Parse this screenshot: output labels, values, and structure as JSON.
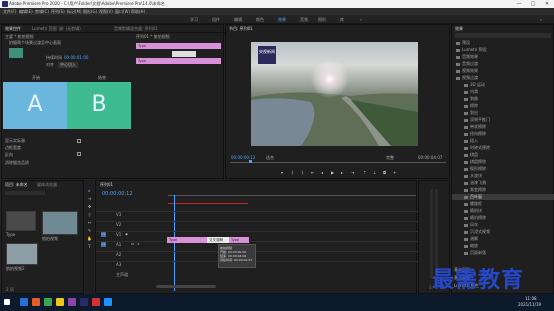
{
  "titlebar": {
    "title": "Adobe Premiere Pro 2020 - C:\\用户\\Folder\\文档\\Adobe\\Premiere Pro\\14.0\\未命名",
    "min": "—",
    "max": "□",
    "close": "✕"
  },
  "menubar": {
    "items": [
      "文件(F)",
      "编辑(E)",
      "剪辑(C)",
      "序列(S)",
      "标记(M)",
      "图形(G)",
      "视图(V)",
      "窗口(W)",
      "帮助(H)"
    ]
  },
  "workspaces": {
    "items": [
      "学习",
      "组件",
      "编辑",
      "颜色",
      "效果",
      "音频",
      "图形",
      "库"
    ],
    "active": "效果"
  },
  "effect_controls": {
    "tabs": [
      "效果控件",
      "Lumetri 范围",
      "源: (无剪辑)",
      "音频剪辑混合器: 序列01"
    ],
    "clip_title": "主要 * 航拍视频",
    "sequence": "序列01 * 航拍视频",
    "description": "拍摄两个场景过渡至中心画面",
    "duration_label": "持续时间",
    "duration_value": "00:00:01:00",
    "alignment_label": "对齐",
    "alignment_value": "中心切入",
    "start_label": "开始",
    "end_label": "结束",
    "show_actual_label": "显示实际源",
    "border_width_label": "边框宽度",
    "border_color_label": "边框颜色",
    "reverse_label": "反向",
    "antialias_label": "消除锯齿品质",
    "a_label": "A",
    "b_label": "B",
    "clip_label": "Type",
    "clip_label2": "Type"
  },
  "program": {
    "title": "节目: 序列01",
    "timecode_left": "00:00:00:12",
    "fit": "适合",
    "quality": "完整",
    "timecode_right": "00:00:04:07",
    "logo": "央视新闻"
  },
  "right_panel": {
    "title": "效果",
    "items": [
      {
        "label": "预设",
        "selected": false
      },
      {
        "label": "Lumetri 预设",
        "selected": false
      },
      {
        "label": "音频效果",
        "selected": false
      },
      {
        "label": "音频过渡",
        "selected": false
      },
      {
        "label": "视频效果",
        "selected": false
      },
      {
        "label": "视频过渡",
        "selected": false
      },
      {
        "label": "3D 运动",
        "selected": false
      },
      {
        "label": "内滑",
        "selected": false
      },
      {
        "label": "划像",
        "selected": false
      },
      {
        "label": "擦除",
        "selected": false
      },
      {
        "label": "划出",
        "selected": false
      },
      {
        "label": "双侧平推门",
        "selected": false
      },
      {
        "label": "带状擦除",
        "selected": false
      },
      {
        "label": "径向擦除",
        "selected": false
      },
      {
        "label": "插入",
        "selected": false
      },
      {
        "label": "时钟式擦除",
        "selected": false
      },
      {
        "label": "棋盘",
        "selected": false
      },
      {
        "label": "棋盘擦除",
        "selected": false
      },
      {
        "label": "楔形擦除",
        "selected": false
      },
      {
        "label": "水波块",
        "selected": false
      },
      {
        "label": "油漆飞溅",
        "selected": false
      },
      {
        "label": "渐变擦除",
        "selected": false
      },
      {
        "label": "百叶窗",
        "selected": true
      },
      {
        "label": "螺旋框",
        "selected": false
      },
      {
        "label": "随机块",
        "selected": false
      },
      {
        "label": "随机擦除",
        "selected": false
      },
      {
        "label": "风车",
        "selected": false
      },
      {
        "label": "沉浸式视频",
        "selected": false
      },
      {
        "label": "溶解",
        "selected": false
      },
      {
        "label": "缩放",
        "selected": false
      },
      {
        "label": "页面剥落",
        "selected": false
      }
    ],
    "bottom_items": [
      "基本图形",
      "基本声音",
      "Lumetri 颜色"
    ]
  },
  "project": {
    "tabs": [
      "项目: 未命名",
      "媒体浏览器"
    ],
    "search_placeholder": "",
    "thumb_labels": [
      "Type",
      "航拍视频",
      "航拍视频2"
    ],
    "footer": "2 项"
  },
  "timeline": {
    "tab": "序列01",
    "timecode": "00:00:00:12",
    "track_labels": [
      "V3",
      "V2",
      "V1",
      "A1",
      "A2",
      "A3"
    ],
    "mix_label": "主声道",
    "clip1": "Type",
    "clip2": "交叉溶解",
    "clip3": "Type",
    "tooltip_lines": [
      "航拍视频",
      "开始: 00:00:00:00",
      "结束: 00:00:04:06",
      "持续时间: 00:00:04:07"
    ]
  },
  "status": {
    "message": "单击以选择，或单击空白处并拖动以框选。"
  },
  "taskbar": {
    "time": "11:08",
    "date": "2021/11/19",
    "icons": [
      "#2a6fd6",
      "#e85b2a",
      "#3aa64f",
      "#f0c419",
      "#8e44ad",
      "#2a2a68",
      "#d63031",
      "#1e90ff"
    ]
  },
  "watermark": "最需教育"
}
